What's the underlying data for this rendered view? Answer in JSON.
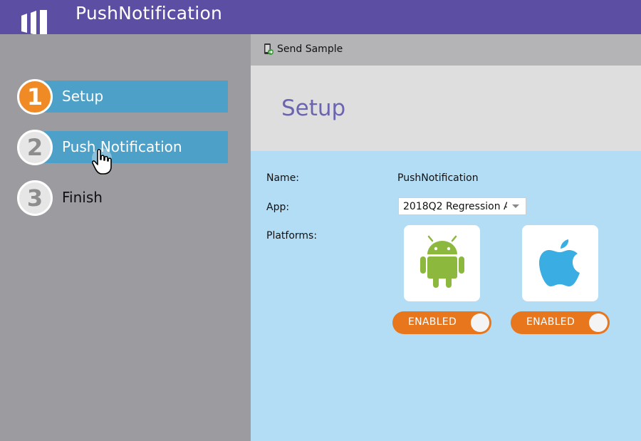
{
  "app": {
    "title": "PushNotification"
  },
  "wizard": {
    "steps": [
      {
        "number": "1",
        "label": "Setup",
        "state": "active"
      },
      {
        "number": "2",
        "label": "Push Notification",
        "state": "hover"
      },
      {
        "number": "3",
        "label": "Finish",
        "state": "idle"
      }
    ]
  },
  "toolbar": {
    "send_sample_label": "Send Sample"
  },
  "main": {
    "title": "Setup",
    "fields": {
      "name_label": "Name:",
      "name_value": "PushNotification",
      "app_label": "App:",
      "app_value": "2018Q2 Regression A",
      "platforms_label": "Platforms:"
    },
    "platforms": [
      {
        "name": "android-icon",
        "toggle_label": "ENABLED"
      },
      {
        "name": "apple-icon",
        "toggle_label": "ENABLED"
      }
    ]
  },
  "colors": {
    "header": "#5c4fa3",
    "step_active": "#f08a25",
    "step_bar": "#4da0c8",
    "toggle": "#e8761c",
    "android": "#8cb83e",
    "apple": "#3aaee2"
  }
}
